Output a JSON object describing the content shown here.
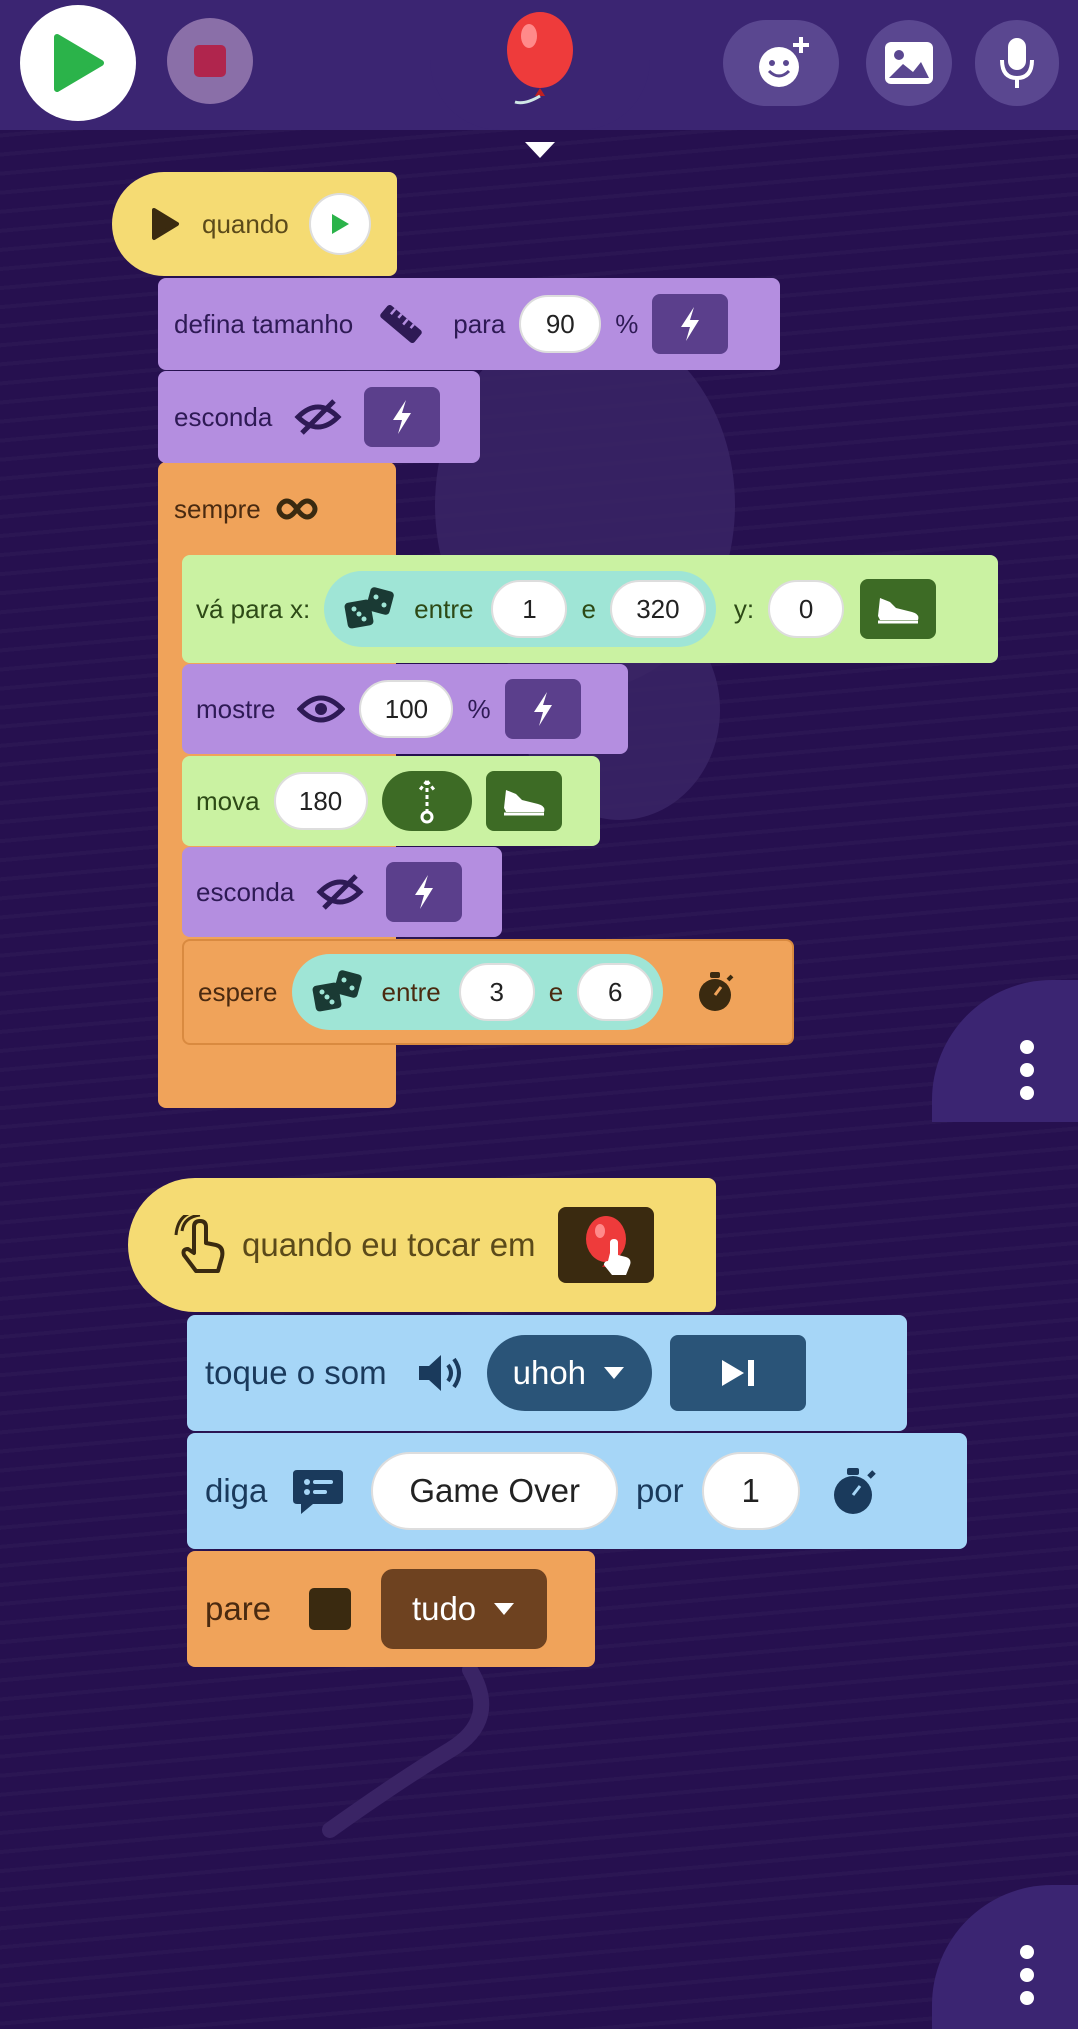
{
  "toolbar": {
    "play": "play-icon",
    "stop": "stop-icon",
    "add_sprite": "add-character-icon",
    "background": "image-icon",
    "record": "microphone-icon",
    "sprite": "balloon-icon",
    "expand": "chevron-down-icon"
  },
  "script1": {
    "hat_label": "quando",
    "set_size_label": "defina tamanho",
    "set_size_para": "para",
    "set_size_value": "90",
    "set_size_unit": "%",
    "hide1_label": "esconda",
    "forever_label": "sempre",
    "goto_label": "vá para x:",
    "goto_between": "entre",
    "goto_min": "1",
    "goto_and": "e",
    "goto_max": "320",
    "goto_y_label": "y:",
    "goto_y_value": "0",
    "show_label": "mostre",
    "show_value": "100",
    "show_unit": "%",
    "move_label": "mova",
    "move_value": "180",
    "hide2_label": "esconda",
    "wait_label": "espere",
    "wait_between": "entre",
    "wait_min": "3",
    "wait_and": "e",
    "wait_max": "6"
  },
  "script2": {
    "hat_label": "quando eu tocar em",
    "sound_label": "toque o som",
    "sound_value": "uhoh",
    "say_label": "diga",
    "say_text": "Game Over",
    "say_por": "por",
    "say_seconds": "1",
    "stop_label": "pare",
    "stop_value": "tudo"
  },
  "colors": {
    "background": "#26104f",
    "events": "#f5db73",
    "looks": "#b48ee0",
    "control": "#f0a35a",
    "motion": "#caf2a2",
    "sound": "#a6d6f7",
    "operators": "#9fe5d6"
  }
}
